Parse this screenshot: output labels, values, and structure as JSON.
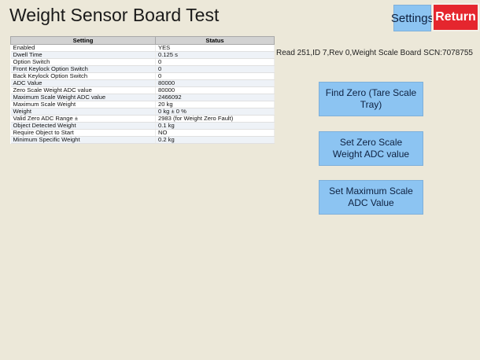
{
  "header": {
    "title": "Weight Sensor Board Test",
    "settings_label": "Settings",
    "return_label": "Return"
  },
  "table": {
    "columns": [
      "Setting",
      "Status"
    ],
    "rows": [
      [
        "Enabled",
        "YES"
      ],
      [
        "Dwell Time",
        "0.125 s"
      ],
      [
        "Option Switch",
        "0"
      ],
      [
        "Front Keylock Option Switch",
        "0"
      ],
      [
        "Back Keylock Option Switch",
        "0"
      ],
      [
        "ADC Value",
        "80000"
      ],
      [
        "Zero Scale Weight ADC value",
        "80000"
      ],
      [
        "Maximum Scale Weight ADC value",
        "2466092"
      ],
      [
        "Maximum Scale Weight",
        "20 kg"
      ],
      [
        "Weight",
        "0 kg ± 0 %"
      ],
      [
        "Valid Zero ADC Range ±",
        "2983 (for Weight Zero Fault)"
      ],
      [
        "Object Detected Weight",
        "0.1 kg"
      ],
      [
        "Require Object to Start",
        "NO"
      ],
      [
        "Minimum Specific Weight",
        "0.2 kg"
      ]
    ]
  },
  "board_info": "Read 251,ID 7,Rev 0,Weight Scale Board SCN:7078755",
  "actions": {
    "find_zero": "Find Zero (Tare Scale Tray)",
    "set_zero": "Set Zero Scale Weight ADC value",
    "set_max": "Set Maximum Scale ADC Value"
  },
  "colors": {
    "background": "#ece8d9",
    "button_blue": "#8cc4f2",
    "return_red": "#e5262e"
  }
}
